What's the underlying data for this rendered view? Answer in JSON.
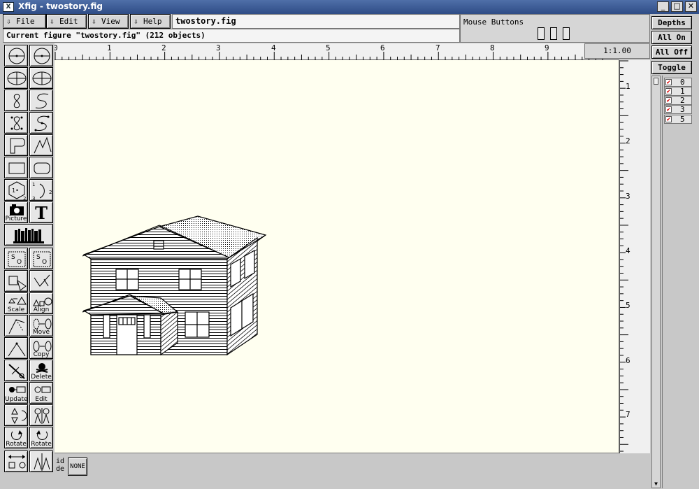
{
  "window": {
    "title": "Xfig - twostory.fig",
    "app_icon": "xfig-icon",
    "buttons": [
      "minimize-icon",
      "maximize-icon",
      "close-icon"
    ]
  },
  "menubar": {
    "file": "File",
    "edit": "Edit",
    "view": "View",
    "help": "Help"
  },
  "filename": "twostory.fig",
  "message": "Current figure \"twostory.fig\" (212 objects)",
  "mouse_buttons": {
    "label": "Mouse Buttons"
  },
  "zoom": "1:1.00",
  "depths": {
    "title": "Depths",
    "all_on": "All On",
    "all_off": "All Off",
    "toggle": "Toggle",
    "items": [
      {
        "label": "0",
        "checked": true
      },
      {
        "label": "1",
        "checked": true
      },
      {
        "label": "2",
        "checked": true
      },
      {
        "label": "3",
        "checked": true
      },
      {
        "label": "5",
        "checked": true
      }
    ]
  },
  "rulers": {
    "top": [
      "0",
      "1",
      "2",
      "3",
      "4",
      "5",
      "6",
      "7",
      "8",
      "9"
    ],
    "side": [
      "1",
      "2",
      "3",
      "4",
      "5",
      "6",
      "7"
    ]
  },
  "tools": {
    "picture": "Picture",
    "scale": "Scale",
    "align": "Align",
    "move": "Move",
    "copy": "Copy",
    "delete": "Delete",
    "update": "Update",
    "edit": "Edit",
    "rotate_cw": "Rotate",
    "rotate_ccw": "Rotate",
    "text_glyph": "T"
  },
  "bottom": {
    "grid_mode": "id\nde",
    "none": "NONE"
  }
}
